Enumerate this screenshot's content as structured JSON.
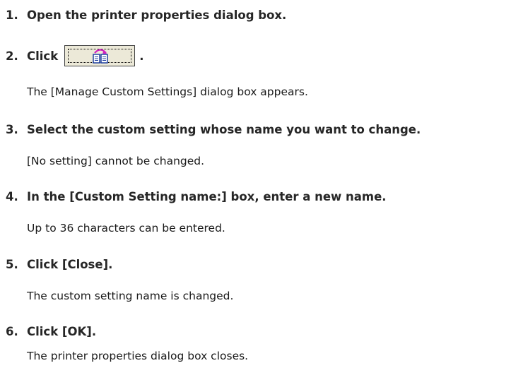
{
  "steps": [
    {
      "num": "1.",
      "text": "Open the printer properties dialog box."
    },
    {
      "num": "2.",
      "text": "Click",
      "suffix": ".",
      "note": "The [Manage Custom Settings] dialog box appears."
    },
    {
      "num": "3.",
      "text": "Select the custom setting whose name you want to change.",
      "note": "[No setting] cannot be changed."
    },
    {
      "num": "4.",
      "text": "In the [Custom Setting name:] box, enter a new name.",
      "note": "Up to 36 characters can be entered."
    },
    {
      "num": "5.",
      "text": "Click [Close].",
      "note": "The custom setting name is changed."
    },
    {
      "num": "6.",
      "text": "Click [OK].",
      "note": "The printer properties dialog box closes."
    }
  ],
  "button_icon": "manage-custom-settings-icon",
  "colors": {
    "button_face": "#ece9d8",
    "icon_arrow": "#d020c0",
    "icon_book": "#2040a0"
  }
}
